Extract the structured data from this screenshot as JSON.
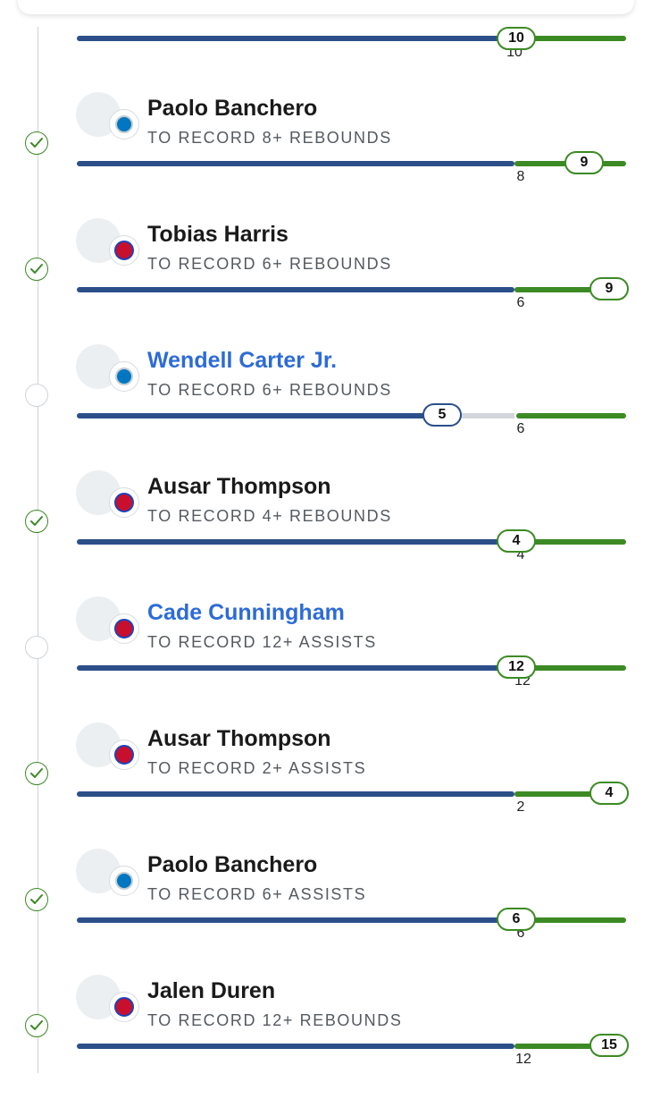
{
  "legs": [
    {
      "name": "",
      "market": "",
      "line": "10",
      "actual": "10",
      "status": "hit",
      "linked": false
    },
    {
      "name": "Paolo Banchero",
      "market": "TO RECORD 8+ REBOUNDS",
      "line": "8",
      "actual": "9",
      "status": "hit",
      "linked": false,
      "team_logo": "magic-logo"
    },
    {
      "name": "Tobias Harris",
      "market": "TO RECORD 6+ REBOUNDS",
      "line": "6",
      "actual": "9",
      "status": "hit",
      "linked": false,
      "team_logo": "pistons-logo"
    },
    {
      "name": "Wendell Carter Jr.",
      "market": "TO RECORD 6+ REBOUNDS",
      "line": "6",
      "actual": "5",
      "status": "open",
      "linked": true,
      "team_logo": "magic-logo"
    },
    {
      "name": "Ausar Thompson",
      "market": "TO RECORD 4+ REBOUNDS",
      "line": "4",
      "actual": "4",
      "status": "hit",
      "linked": false,
      "team_logo": "pistons-logo"
    },
    {
      "name": "Cade Cunningham",
      "market": "TO RECORD 12+ ASSISTS",
      "line": "12",
      "actual": "12",
      "status": "open",
      "linked": true,
      "team_logo": "pistons-logo"
    },
    {
      "name": "Ausar Thompson",
      "market": "TO RECORD 2+ ASSISTS",
      "line": "2",
      "actual": "4",
      "status": "hit",
      "linked": false,
      "team_logo": "pistons-logo"
    },
    {
      "name": "Paolo Banchero",
      "market": "TO RECORD 6+ ASSISTS",
      "line": "6",
      "actual": "6",
      "status": "hit",
      "linked": false,
      "team_logo": "magic-logo"
    },
    {
      "name": "Jalen Duren",
      "market": "TO RECORD 12+ REBOUNDS",
      "line": "12",
      "actual": "15",
      "status": "hit",
      "linked": false,
      "team_logo": "pistons-logo"
    }
  ],
  "colors": {
    "progress_blue": "#2c4f8a",
    "hit_green": "#3c8a24",
    "link_blue": "#2d6bd6",
    "remaining_grey": "#d3d6da"
  }
}
